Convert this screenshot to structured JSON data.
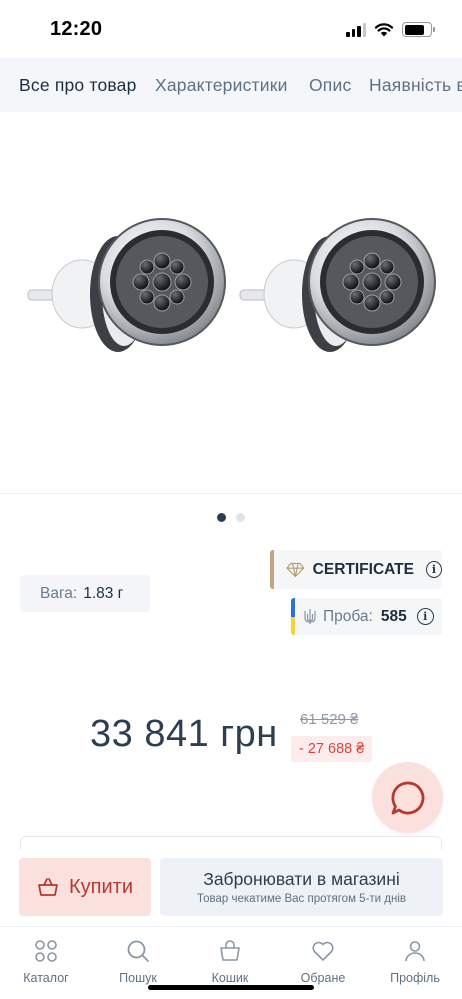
{
  "status_bar": {
    "time": "12:20"
  },
  "tabs": [
    {
      "label": "Все про товар",
      "active": true
    },
    {
      "label": "Характеристики",
      "active": false
    },
    {
      "label": "Опис",
      "active": false
    },
    {
      "label": "Наявність в",
      "active": false
    }
  ],
  "gallery": {
    "image": "earrings-with-black-stones",
    "slides": 2,
    "current_slide": 1
  },
  "specs": {
    "weight_label": "Вага:",
    "weight_value": "1.83 г",
    "certificate_label": "CERTIFICATE",
    "hallmark_label": "Проба:",
    "hallmark_value": "585"
  },
  "pricing": {
    "price": "33 841 грн",
    "old_price": "61 529 ₴",
    "discount": "- 27 688 ₴"
  },
  "actions": {
    "buy_label": "Купити",
    "reserve_label": "Забронювати в магазині",
    "reserve_sub": "Товар чекатиме Вас протягом 5-ти днів"
  },
  "bottom_nav": [
    {
      "label": "Каталог",
      "icon": "catalog-icon"
    },
    {
      "label": "Пошук",
      "icon": "search-icon"
    },
    {
      "label": "Кошик",
      "icon": "basket-icon"
    },
    {
      "label": "Обране",
      "icon": "heart-icon"
    },
    {
      "label": "Профіль",
      "icon": "profile-icon"
    }
  ],
  "colors": {
    "accent_buy": "#fbe1dd",
    "accent_buy_text": "#b73a2e",
    "discount_text": "#d9453d",
    "certificate_border": "#c4a47c",
    "flag_blue": "#2f6fd6",
    "flag_yellow": "#f6d23c"
  }
}
